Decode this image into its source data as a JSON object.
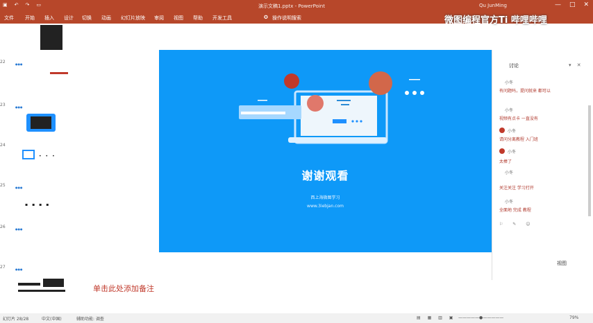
{
  "window": {
    "title": "演示文稿1.pptx - PowerPoint",
    "user": "Qu JunMing",
    "controls": [
      "—",
      "□",
      "✕"
    ]
  },
  "watermark": "微图编程官方Ti 哔哩哔哩",
  "ribbon_tabs": [
    "文件",
    "开始",
    "插入",
    "设计",
    "切换",
    "动画",
    "幻灯片放映",
    "审阅",
    "视图",
    "帮助",
    "开发工具",
    "操作说明搜索"
  ],
  "thumbnails": [
    {
      "number": "22"
    },
    {
      "number": "23"
    },
    {
      "number": "24"
    },
    {
      "number": "25"
    },
    {
      "number": "26"
    },
    {
      "number": "27"
    }
  ],
  "slide": {
    "title": "谢谢观看",
    "subtitle": "西上海微图学习",
    "url": "www.3iebjan.com",
    "background": "#0e99f8"
  },
  "notes_placeholder": "单击此处添加备注",
  "comments_pane": {
    "header": "讨论",
    "items": [
      {
        "name": "小冬",
        "text": "有问题吗，提问就来 都可以"
      },
      {
        "name": "小冬",
        "text": "视频有点卡 一直没有"
      },
      {
        "name": "小冬",
        "text": "请问分离教程 入门班"
      },
      {
        "name": "小冬",
        "text": "太棒了"
      },
      {
        "name": "小冬",
        "text": "关注关注 学习打开"
      },
      {
        "name": "小冬",
        "text": "全面地 完成 教程"
      }
    ]
  },
  "view_label": "视图",
  "statusbar": {
    "slide_info": "幻灯片 28/28",
    "language": "中文(中国)",
    "accessibility": "辅助功能: 调查",
    "zoom": "79%"
  }
}
